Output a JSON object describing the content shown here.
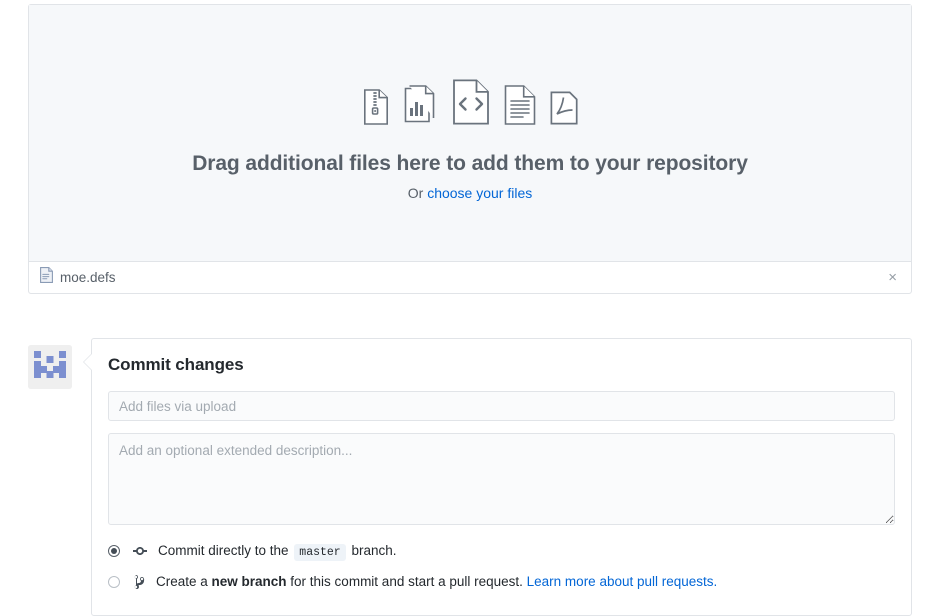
{
  "dropzone": {
    "title": "Drag additional files here to add them to your repository",
    "or_label": "Or ",
    "choose_link": "choose your files",
    "file_type_icons": [
      "zip-file-icon",
      "chart-file-icon",
      "code-file-icon",
      "text-file-icon",
      "pdf-file-icon"
    ]
  },
  "file_list": {
    "items": [
      {
        "icon": "file-icon",
        "name": "moe.defs",
        "remove_label": "×"
      }
    ]
  },
  "commit": {
    "avatar": "identicon-avatar",
    "title": "Commit changes",
    "summary_value": "",
    "summary_placeholder": "Add files via upload",
    "description_value": "",
    "description_placeholder": "Add an optional extended description...",
    "options": [
      {
        "id": "commit-direct",
        "icon": "git-commit-icon",
        "selected": true,
        "text_before": "Commit directly to the ",
        "branch": "master",
        "text_after": " branch."
      },
      {
        "id": "create-branch",
        "icon": "git-branch-icon",
        "selected": false,
        "text_before": "Create a ",
        "bold": "new branch",
        "text_after": " for this commit and start a pull request. ",
        "link": "Learn more about pull requests."
      }
    ]
  },
  "colors": {
    "accent_link": "#0366d6",
    "muted_text": "#586069",
    "border": "#e1e4e8",
    "dropzone_bg": "#f6f8fa",
    "identicon": "#7c8fd0"
  }
}
